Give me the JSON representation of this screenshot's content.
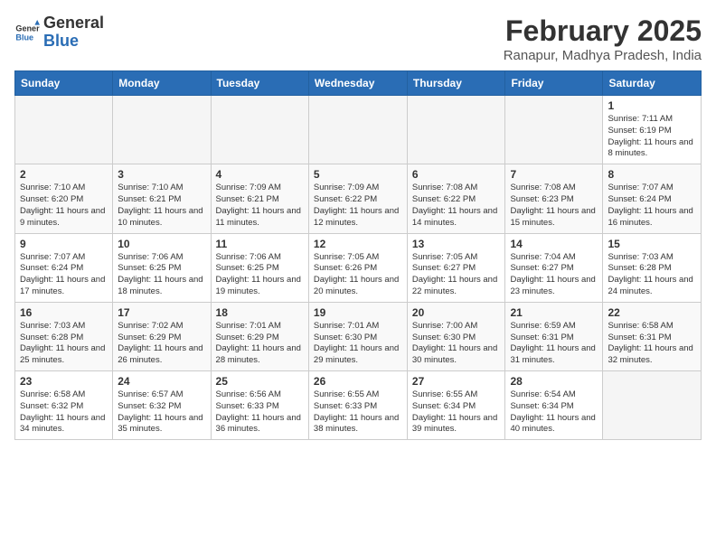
{
  "header": {
    "logo_general": "General",
    "logo_blue": "Blue",
    "month_title": "February 2025",
    "location": "Ranapur, Madhya Pradesh, India"
  },
  "weekdays": [
    "Sunday",
    "Monday",
    "Tuesday",
    "Wednesday",
    "Thursday",
    "Friday",
    "Saturday"
  ],
  "weeks": [
    [
      {
        "day": "",
        "info": ""
      },
      {
        "day": "",
        "info": ""
      },
      {
        "day": "",
        "info": ""
      },
      {
        "day": "",
        "info": ""
      },
      {
        "day": "",
        "info": ""
      },
      {
        "day": "",
        "info": ""
      },
      {
        "day": "1",
        "info": "Sunrise: 7:11 AM\nSunset: 6:19 PM\nDaylight: 11 hours and 8 minutes."
      }
    ],
    [
      {
        "day": "2",
        "info": "Sunrise: 7:10 AM\nSunset: 6:20 PM\nDaylight: 11 hours and 9 minutes."
      },
      {
        "day": "3",
        "info": "Sunrise: 7:10 AM\nSunset: 6:21 PM\nDaylight: 11 hours and 10 minutes."
      },
      {
        "day": "4",
        "info": "Sunrise: 7:09 AM\nSunset: 6:21 PM\nDaylight: 11 hours and 11 minutes."
      },
      {
        "day": "5",
        "info": "Sunrise: 7:09 AM\nSunset: 6:22 PM\nDaylight: 11 hours and 12 minutes."
      },
      {
        "day": "6",
        "info": "Sunrise: 7:08 AM\nSunset: 6:22 PM\nDaylight: 11 hours and 14 minutes."
      },
      {
        "day": "7",
        "info": "Sunrise: 7:08 AM\nSunset: 6:23 PM\nDaylight: 11 hours and 15 minutes."
      },
      {
        "day": "8",
        "info": "Sunrise: 7:07 AM\nSunset: 6:24 PM\nDaylight: 11 hours and 16 minutes."
      }
    ],
    [
      {
        "day": "9",
        "info": "Sunrise: 7:07 AM\nSunset: 6:24 PM\nDaylight: 11 hours and 17 minutes."
      },
      {
        "day": "10",
        "info": "Sunrise: 7:06 AM\nSunset: 6:25 PM\nDaylight: 11 hours and 18 minutes."
      },
      {
        "day": "11",
        "info": "Sunrise: 7:06 AM\nSunset: 6:25 PM\nDaylight: 11 hours and 19 minutes."
      },
      {
        "day": "12",
        "info": "Sunrise: 7:05 AM\nSunset: 6:26 PM\nDaylight: 11 hours and 20 minutes."
      },
      {
        "day": "13",
        "info": "Sunrise: 7:05 AM\nSunset: 6:27 PM\nDaylight: 11 hours and 22 minutes."
      },
      {
        "day": "14",
        "info": "Sunrise: 7:04 AM\nSunset: 6:27 PM\nDaylight: 11 hours and 23 minutes."
      },
      {
        "day": "15",
        "info": "Sunrise: 7:03 AM\nSunset: 6:28 PM\nDaylight: 11 hours and 24 minutes."
      }
    ],
    [
      {
        "day": "16",
        "info": "Sunrise: 7:03 AM\nSunset: 6:28 PM\nDaylight: 11 hours and 25 minutes."
      },
      {
        "day": "17",
        "info": "Sunrise: 7:02 AM\nSunset: 6:29 PM\nDaylight: 11 hours and 26 minutes."
      },
      {
        "day": "18",
        "info": "Sunrise: 7:01 AM\nSunset: 6:29 PM\nDaylight: 11 hours and 28 minutes."
      },
      {
        "day": "19",
        "info": "Sunrise: 7:01 AM\nSunset: 6:30 PM\nDaylight: 11 hours and 29 minutes."
      },
      {
        "day": "20",
        "info": "Sunrise: 7:00 AM\nSunset: 6:30 PM\nDaylight: 11 hours and 30 minutes."
      },
      {
        "day": "21",
        "info": "Sunrise: 6:59 AM\nSunset: 6:31 PM\nDaylight: 11 hours and 31 minutes."
      },
      {
        "day": "22",
        "info": "Sunrise: 6:58 AM\nSunset: 6:31 PM\nDaylight: 11 hours and 32 minutes."
      }
    ],
    [
      {
        "day": "23",
        "info": "Sunrise: 6:58 AM\nSunset: 6:32 PM\nDaylight: 11 hours and 34 minutes."
      },
      {
        "day": "24",
        "info": "Sunrise: 6:57 AM\nSunset: 6:32 PM\nDaylight: 11 hours and 35 minutes."
      },
      {
        "day": "25",
        "info": "Sunrise: 6:56 AM\nSunset: 6:33 PM\nDaylight: 11 hours and 36 minutes."
      },
      {
        "day": "26",
        "info": "Sunrise: 6:55 AM\nSunset: 6:33 PM\nDaylight: 11 hours and 38 minutes."
      },
      {
        "day": "27",
        "info": "Sunrise: 6:55 AM\nSunset: 6:34 PM\nDaylight: 11 hours and 39 minutes."
      },
      {
        "day": "28",
        "info": "Sunrise: 6:54 AM\nSunset: 6:34 PM\nDaylight: 11 hours and 40 minutes."
      },
      {
        "day": "",
        "info": ""
      }
    ]
  ]
}
